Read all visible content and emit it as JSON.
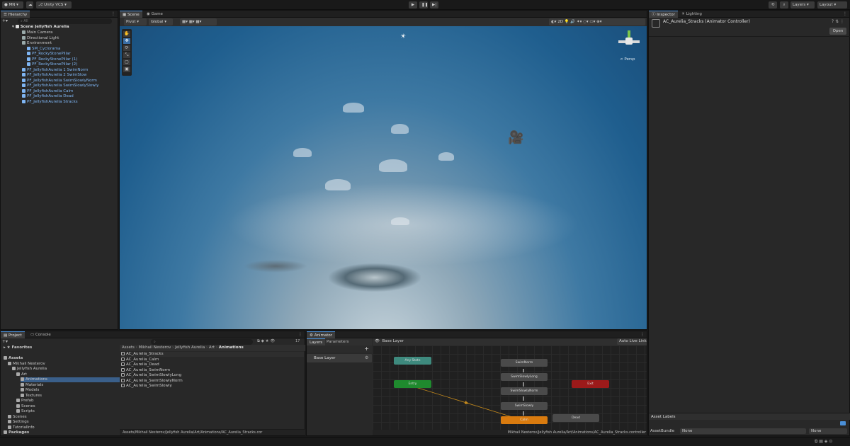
{
  "toolbar": {
    "account": "MN",
    "vcs": "Unity VCS",
    "layers": "Layers",
    "layout": "Layout"
  },
  "hierarchy": {
    "tab": "Hierarchy",
    "search_placeholder": "All",
    "scene": "Scene Jellyfish Aurelia",
    "items": [
      {
        "label": "Main Camera",
        "indent": 2,
        "prefab": false
      },
      {
        "label": "Directional Light",
        "indent": 2,
        "prefab": false
      },
      {
        "label": "Environment",
        "indent": 2,
        "prefab": false
      },
      {
        "label": "SM_Cyclorama",
        "indent": 3,
        "prefab": true
      },
      {
        "label": "PF_RockyStonePillar",
        "indent": 3,
        "prefab": true
      },
      {
        "label": "PF_RockyStonePillar (1)",
        "indent": 3,
        "prefab": true
      },
      {
        "label": "PF_RockyStonePillar (2)",
        "indent": 3,
        "prefab": true
      },
      {
        "label": "PF_JellyfishAurelia 1 SwimNorm",
        "indent": 2,
        "prefab": true
      },
      {
        "label": "PF_JellyfishAurelia 2 SwimSlow",
        "indent": 2,
        "prefab": true
      },
      {
        "label": "PF_JellyfishAurelia SwimSlowlyNorm",
        "indent": 2,
        "prefab": true
      },
      {
        "label": "PF_JellyfishAurelia SwimSlowlySlowly",
        "indent": 2,
        "prefab": true
      },
      {
        "label": "PF_JellyfishAurelia Calm",
        "indent": 2,
        "prefab": true
      },
      {
        "label": "PF_JellyfishAurelia Dead",
        "indent": 2,
        "prefab": true
      },
      {
        "label": "PF_JellyfishAurelia Stracks",
        "indent": 2,
        "prefab": true
      }
    ]
  },
  "scene": {
    "tabs": [
      "Scene",
      "Game"
    ],
    "pivot": "Pivot",
    "global": "Global",
    "persp": "< Persp"
  },
  "inspector": {
    "tabs": [
      "Inspector",
      "Lighting"
    ],
    "title": "AC_Aurelia_Stracks (Animator Controller)",
    "open": "Open",
    "asset_labels": "Asset Labels",
    "asset_bundle": "AssetBundle",
    "none1": "None",
    "none2": "None"
  },
  "project": {
    "tabs": [
      "Project",
      "Console"
    ],
    "favorites": "Favorites",
    "count": "17",
    "tree": [
      {
        "label": "Assets",
        "indent": 0,
        "bold": true
      },
      {
        "label": "Mikhail Nesterov",
        "indent": 1,
        "bold": false
      },
      {
        "label": "Jellyfish Aurelia",
        "indent": 2,
        "bold": false
      },
      {
        "label": "Art",
        "indent": 3,
        "bold": false
      },
      {
        "label": "Animations",
        "indent": 4,
        "bold": false,
        "selected": true
      },
      {
        "label": "Materials",
        "indent": 4,
        "bold": false
      },
      {
        "label": "Models",
        "indent": 4,
        "bold": false
      },
      {
        "label": "Textures",
        "indent": 4,
        "bold": false
      },
      {
        "label": "Prefab",
        "indent": 3,
        "bold": false
      },
      {
        "label": "Scenes",
        "indent": 3,
        "bold": false
      },
      {
        "label": "Scripts",
        "indent": 3,
        "bold": false
      },
      {
        "label": "Scenes",
        "indent": 1,
        "bold": false
      },
      {
        "label": "Settings",
        "indent": 1,
        "bold": false
      },
      {
        "label": "TutorialInfo",
        "indent": 1,
        "bold": false
      },
      {
        "label": "Packages",
        "indent": 0,
        "bold": true
      }
    ],
    "breadcrumb": [
      "Assets",
      "Mikhail Nesterov",
      "Jellyfish Aurelia",
      "Art",
      "Animations"
    ],
    "files": [
      "AC_Aurelia_Stracks",
      "AC_Aurelia_Calm",
      "AC_Aurelia_Dead",
      "AC_Aurelia_SwimNorm",
      "AC_Aurelia_SwimSlowlyLong",
      "AC_Aurelia_SwimSlowlyNorm",
      "AC_Aurelia_SwimSlowly"
    ],
    "path": "Assets/Mikhail Nesterov/Jellyfish Aurelia/Art/Animations/AC_Aurelia_Stracks.cor"
  },
  "animator": {
    "tab": "Animator",
    "layers": "Layers",
    "parameters": "Parameters",
    "base_layer_tab": "Base Layer",
    "auto_live": "Auto Live Link",
    "base_layer": "Base Layer",
    "path": "Mikhail Nesterov/Jellyfish Aurelia/Art/Animations/AC_Aurelia_Stracks.controller",
    "nodes": {
      "any": "Any State",
      "entry": "Entry",
      "exit": "Exit",
      "swimnorm": "SwimNorm",
      "slowlylong": "SwimSlowlyLong",
      "slowlynorm": "SwimSlowlyNorm",
      "swimslowly": "SwimSlowly",
      "calm": "Calm",
      "dead": "Dead"
    }
  },
  "colors": {
    "accent": "#4a8fd8",
    "prefab": "#7fb6f4",
    "entry": "#1f8a2e",
    "exit": "#9c1a1a",
    "default_state": "#d97b0f",
    "any": "#3e8a7e"
  }
}
